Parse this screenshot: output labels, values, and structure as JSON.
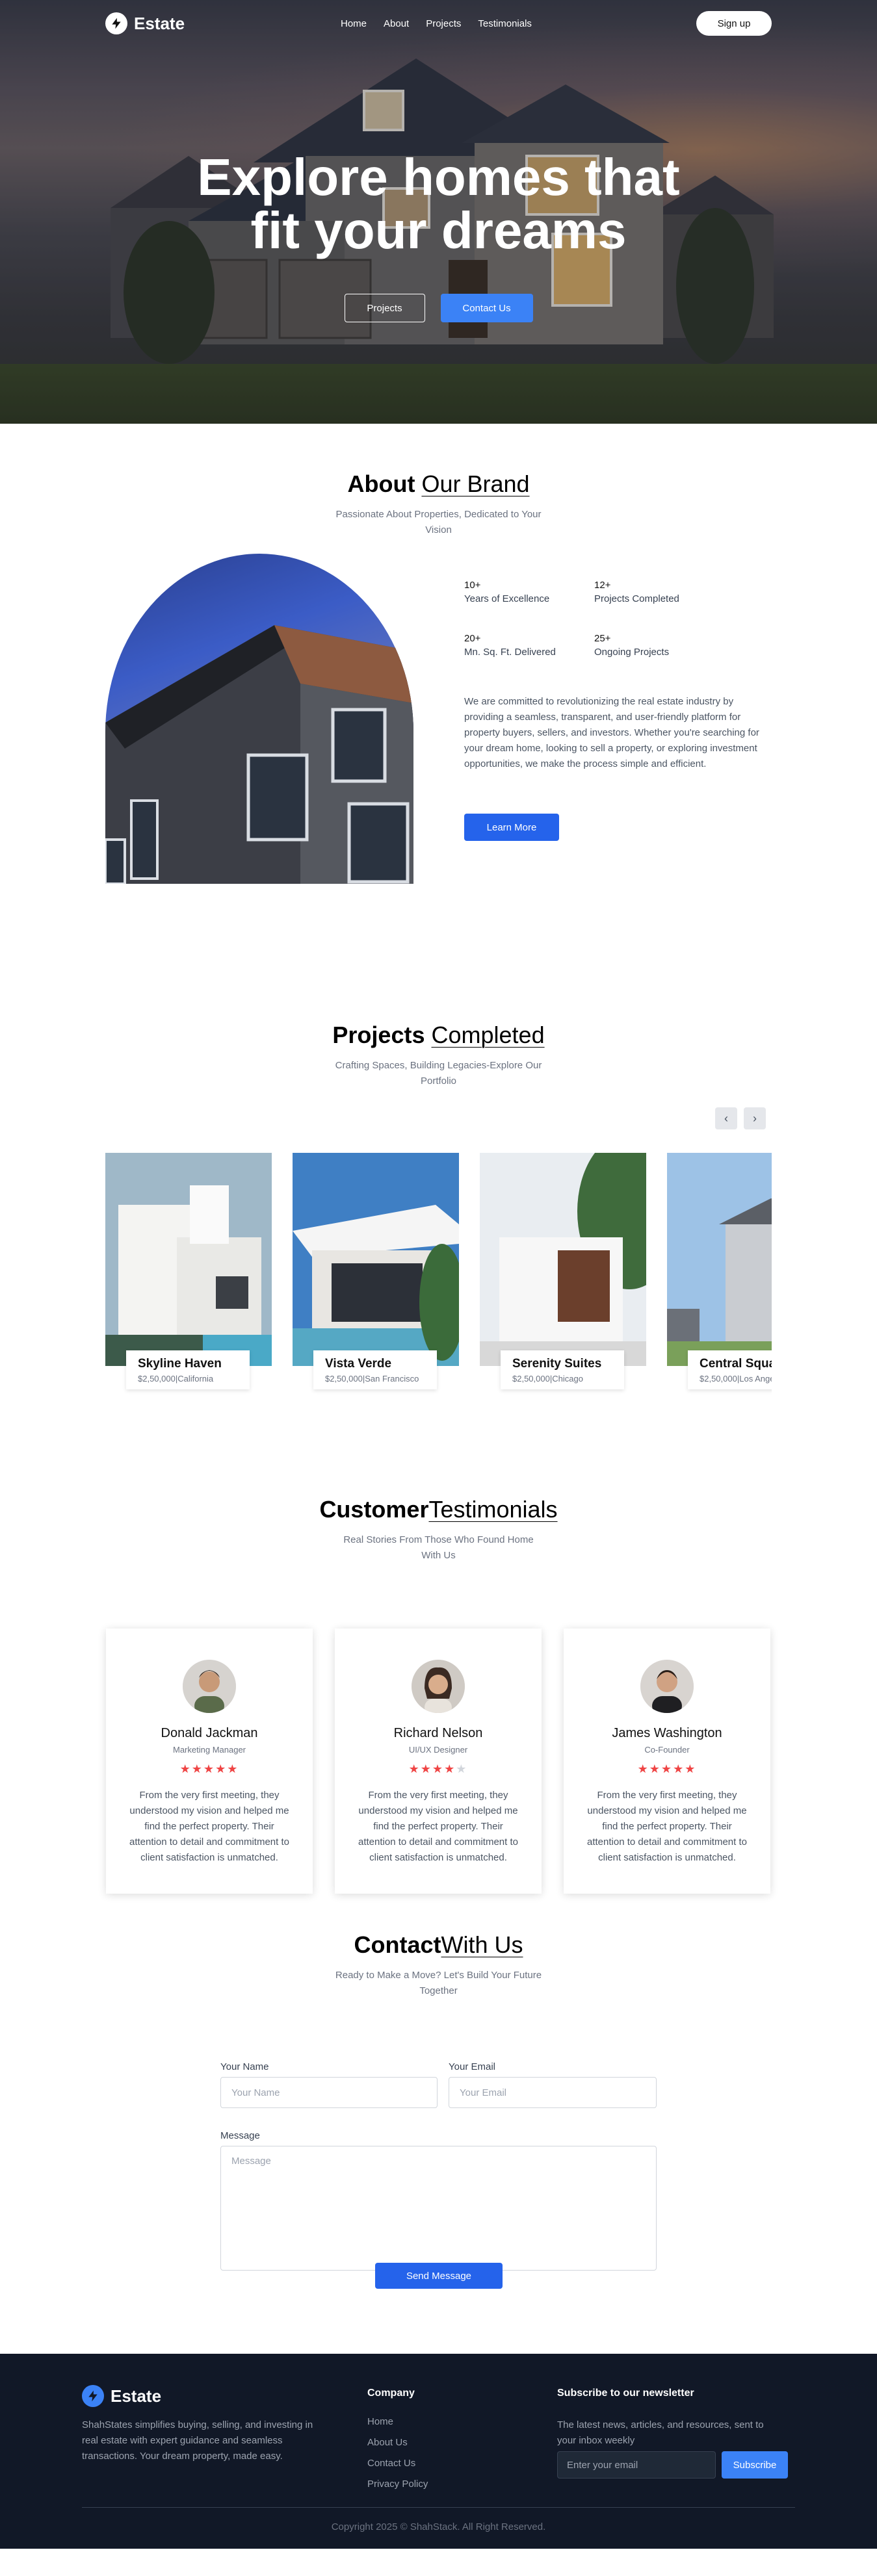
{
  "nav": {
    "brand": "Estate",
    "links": [
      "Home",
      "About",
      "Projects",
      "Testimonials"
    ],
    "signup_label": "Sign up"
  },
  "hero": {
    "title": "Explore homes that fit your dreams",
    "projects_button": "Projects",
    "contact_button": "Contact Us"
  },
  "about": {
    "title_bold": "About",
    "title_light": "Our Brand",
    "subtitle": "Passionate About Properties, Dedicated to Your Vision",
    "stats": [
      {
        "value": "10+",
        "label": "Years of Excellence"
      },
      {
        "value": "12+",
        "label": "Projects Completed"
      },
      {
        "value": "20+",
        "label": "Mn. Sq. Ft. Delivered"
      },
      {
        "value": "25+",
        "label": "Ongoing Projects"
      }
    ],
    "description": "We are committed to revolutionizing the real estate industry by providing a seamless, transparent, and user-friendly platform for property buyers, sellers, and investors. Whether you're searching for your dream home, looking to sell a property, or exploring investment opportunities, we make the process simple and efficient.",
    "learn_more": "Learn More"
  },
  "projects": {
    "title_bold": "Projects",
    "title_light": "Completed",
    "subtitle": "Crafting Spaces, Building Legacies-Explore Our Portfolio",
    "items": [
      {
        "name": "Skyline Haven",
        "price": "$2,50,000",
        "location": "California"
      },
      {
        "name": "Vista Verde",
        "price": "$2,50,000",
        "location": "San Francisco"
      },
      {
        "name": "Serenity Suites",
        "price": "$2,50,000",
        "location": "Chicago"
      },
      {
        "name": "Central Square",
        "price": "$2,50,000",
        "location": "Los Angeles"
      }
    ]
  },
  "testimonials": {
    "title_bold": "Customer",
    "title_light": "Testimonials",
    "subtitle": "Real Stories From Those Who Found Home With Us",
    "items": [
      {
        "name": "Donald Jackman",
        "role": "Marketing Manager",
        "rating": 5,
        "text": "From the very first meeting, they understood my vision and helped me find the perfect property. Their attention to detail and commitment to client satisfaction is unmatched."
      },
      {
        "name": "Richard Nelson",
        "role": "UI/UX Designer",
        "rating": 4,
        "text": "From the very first meeting, they understood my vision and helped me find the perfect property. Their attention to detail and commitment to client satisfaction is unmatched."
      },
      {
        "name": "James Washington",
        "role": "Co-Founder",
        "rating": 5,
        "text": "From the very first meeting, they understood my vision and helped me find the perfect property. Their attention to detail and commitment to client satisfaction is unmatched."
      }
    ]
  },
  "contact": {
    "title_bold": "Contact",
    "title_light": "With Us",
    "subtitle": "Ready to Make a Move? Let's Build Your Future Together",
    "name_label": "Your Name",
    "name_placeholder": "Your Name",
    "email_label": "Your Email",
    "email_placeholder": "Your Email",
    "message_label": "Message",
    "message_placeholder": "Message",
    "send_label": "Send Message"
  },
  "footer": {
    "brand": "Estate",
    "description": "ShahStates simplifies buying, selling, and investing in real estate with expert guidance and seamless transactions. Your dream property, made easy.",
    "company_title": "Company",
    "company_links": [
      "Home",
      "About Us",
      "Contact Us",
      "Privacy Policy"
    ],
    "newsletter_title": "Subscribe to our newsletter",
    "newsletter_text": "The latest news, articles, and resources, sent to your inbox weekly",
    "email_placeholder": "Enter your email",
    "subscribe_label": "Subscribe",
    "copyright": "Copyright 2025 © ShahStack. All Right Reserved."
  },
  "colors": {
    "accent": "#2563eb",
    "accent_light": "#3b82f6",
    "star": "#ef4444",
    "footer_bg": "#111827"
  },
  "icons": {
    "logo": "lightning-bolt-icon",
    "prev": "chevron-left-icon",
    "next": "chevron-right-icon",
    "star": "star-icon"
  }
}
